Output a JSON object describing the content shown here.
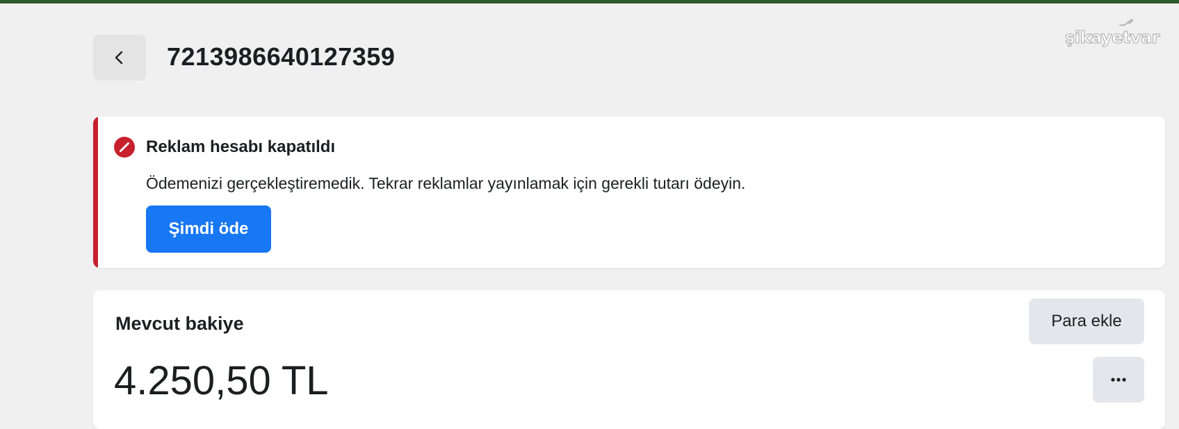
{
  "header": {
    "account_id": "7213986640127359",
    "back_icon": "chevron-left-icon"
  },
  "watermark": {
    "text": "şikayetvar"
  },
  "alert": {
    "title": "Reklam hesabı kapatıldı",
    "message": "Ödemenizi gerçekleştiremedik. Tekrar reklamlar yayınlamak için gerekli tutarı ödeyin.",
    "button_label": "Şimdi öde",
    "icon": "prohibited-icon",
    "accent_color": "#c8202d",
    "button_color": "#1877f2"
  },
  "balance": {
    "label": "Mevcut bakiye",
    "amount": "4.250,50 TL",
    "add_money_label": "Para ekle",
    "more_icon": "more-horizontal-icon"
  }
}
